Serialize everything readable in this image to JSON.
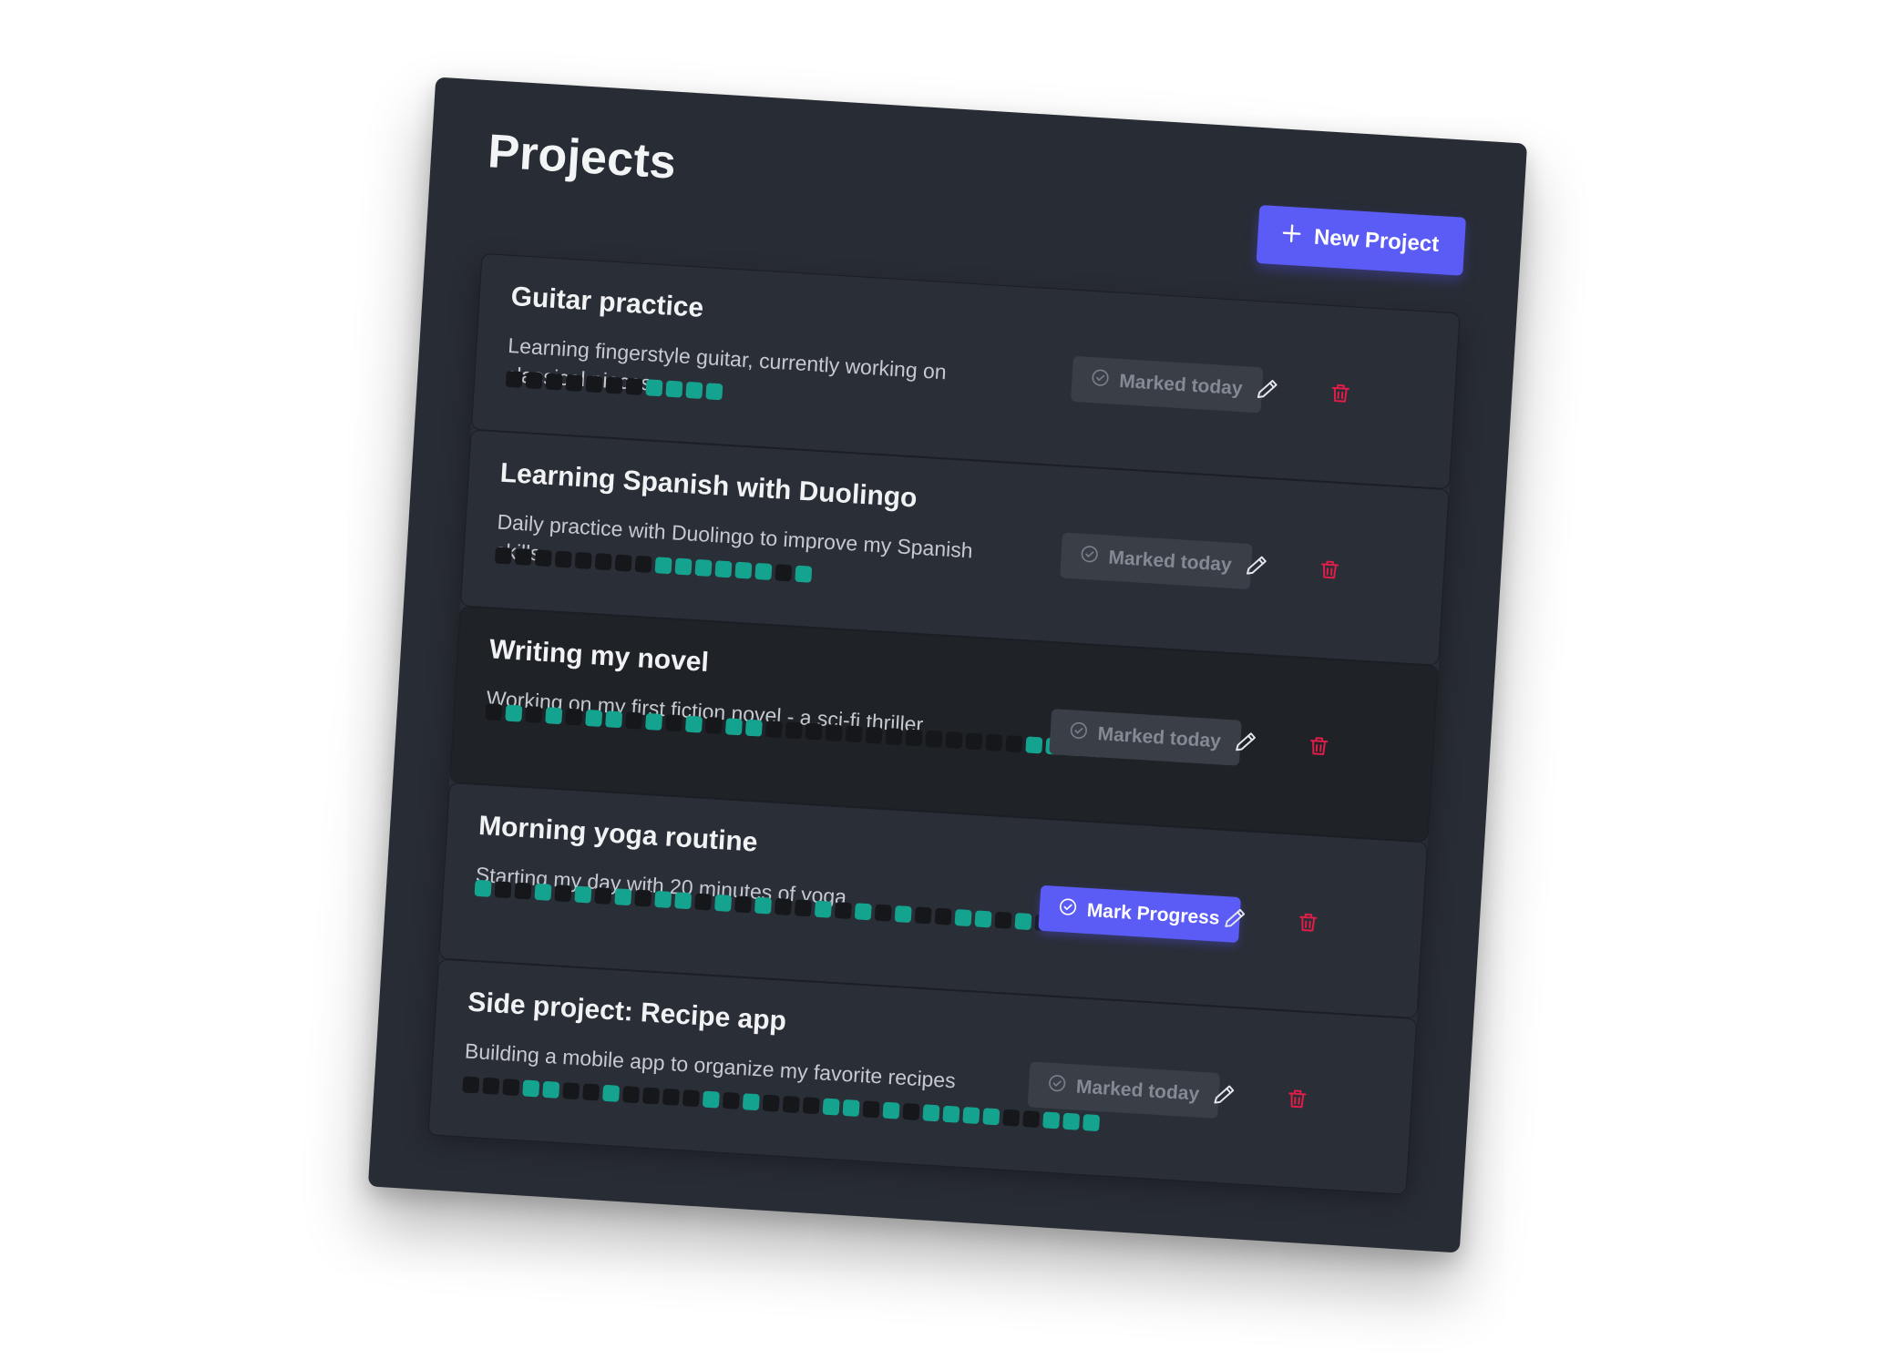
{
  "header": {
    "title": "Projects",
    "new_project_label": "New Project"
  },
  "colors": {
    "accent": "#5b5bf6",
    "progress_on": "#14a38f",
    "progress_off": "#15171b",
    "delete": "#e11d48"
  },
  "icons": {
    "new_project": "plus-icon",
    "status": "check-circle-icon",
    "edit": "pencil-icon",
    "delete": "trash-icon"
  },
  "projects": [
    {
      "title": "Guitar practice",
      "description": "Learning fingerstyle guitar, currently working on classical pieces",
      "status_label": "Marked today",
      "marked": true,
      "progress": [
        0,
        0,
        0,
        0,
        0,
        0,
        0,
        1,
        1,
        1,
        1
      ]
    },
    {
      "title": "Learning Spanish with Duolingo",
      "description": "Daily practice with Duolingo to improve my Spanish skills",
      "status_label": "Marked today",
      "marked": true,
      "progress": [
        0,
        0,
        0,
        0,
        0,
        0,
        0,
        0,
        1,
        1,
        1,
        1,
        1,
        1,
        0,
        1
      ]
    },
    {
      "title": "Writing my novel",
      "description": "Working on my first fiction novel - a sci-fi thriller",
      "status_label": "Marked today",
      "marked": true,
      "progress": [
        0,
        1,
        0,
        1,
        0,
        1,
        1,
        0,
        1,
        0,
        1,
        0,
        1,
        1,
        0,
        0,
        0,
        0,
        0,
        0,
        0,
        0,
        0,
        0,
        0,
        0,
        0,
        1,
        1,
        1,
        1
      ]
    },
    {
      "title": "Morning yoga routine",
      "description": "Starting my day with 20 minutes of yoga",
      "status_label": "Mark Progress",
      "marked": false,
      "progress": [
        1,
        0,
        0,
        1,
        0,
        1,
        0,
        1,
        0,
        1,
        1,
        0,
        1,
        0,
        1,
        0,
        0,
        1,
        0,
        1,
        0,
        1,
        0,
        0,
        1,
        1,
        0,
        1,
        0,
        0,
        1,
        0,
        0
      ]
    },
    {
      "title": "Side project: Recipe app",
      "description": "Building a mobile app to organize my favorite recipes",
      "status_label": "Marked today",
      "marked": true,
      "progress": [
        0,
        0,
        0,
        1,
        1,
        0,
        0,
        1,
        0,
        0,
        0,
        0,
        1,
        0,
        1,
        0,
        0,
        0,
        1,
        1,
        0,
        1,
        0,
        1,
        1,
        1,
        1,
        0,
        0,
        1,
        1,
        1
      ]
    }
  ]
}
